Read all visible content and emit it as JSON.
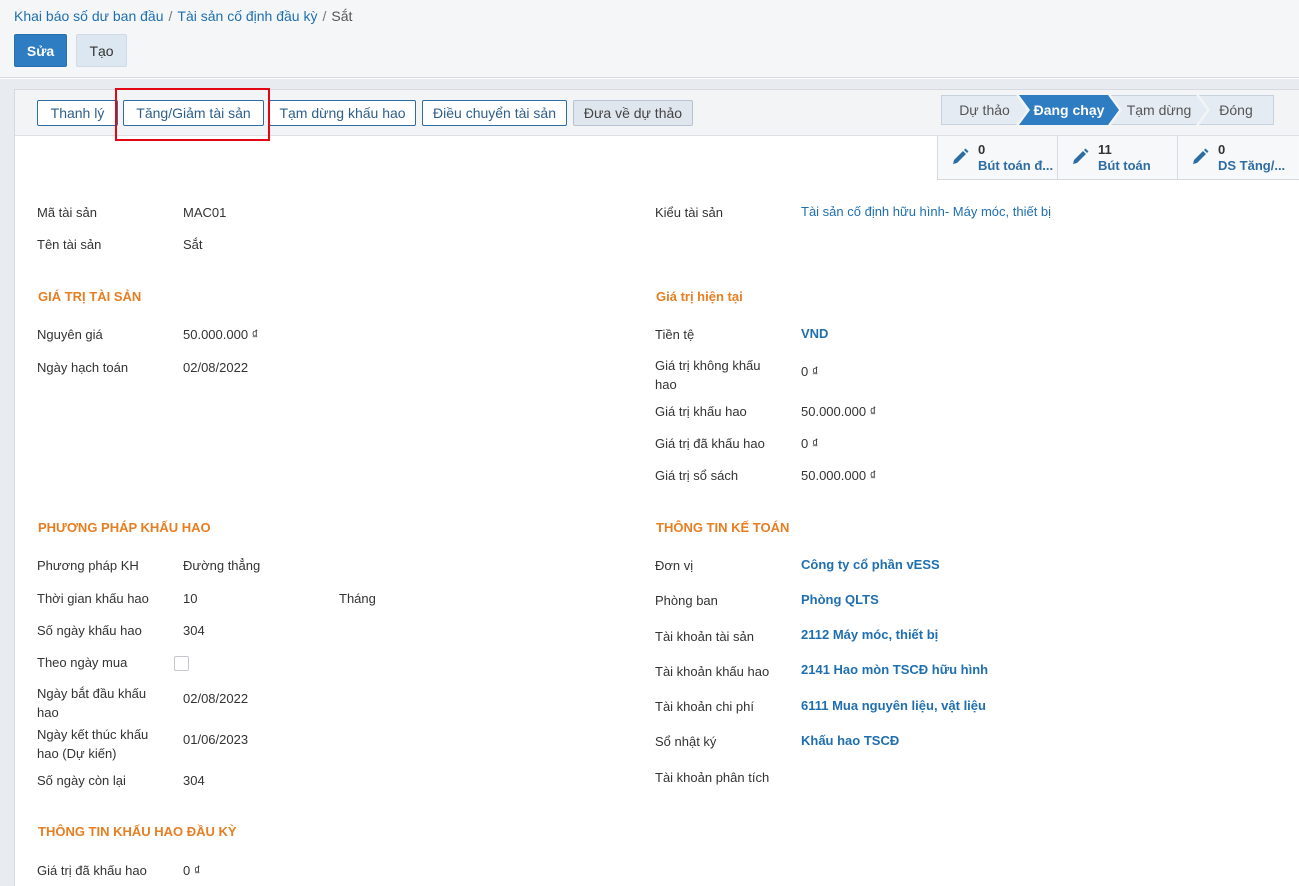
{
  "breadcrumb": {
    "item1": "Khai báo số dư ban đầu",
    "item2": "Tài sản cố định đầu kỳ",
    "current": "Sắt",
    "separator": "/"
  },
  "control": {
    "edit_label": "Sửa",
    "create_label": "Tạo"
  },
  "header_buttons": {
    "liquidate": "Thanh lý",
    "increase_decrease": "Tăng/Giảm tài sản",
    "pause_depreciation": "Tạm dừng khấu hao",
    "transfer": "Điều chuyển tài sản",
    "reset_draft": "Đưa về dự thảo"
  },
  "status": {
    "steps": [
      "Dự thảo",
      "Đang chạy",
      "Tạm dừng",
      "Đóng"
    ],
    "active": "Đang chạy"
  },
  "smart_buttons": [
    {
      "count": "0",
      "label": "Bút toán đ...",
      "icon": "pencil-icon"
    },
    {
      "count": "11",
      "label": "Bút toán",
      "icon": "pencil-icon"
    },
    {
      "count": "0",
      "label": "DS Tăng/...",
      "icon": "pencil-icon"
    }
  ],
  "general": {
    "asset_code_label": "Mã tài sản",
    "asset_code": "MAC01",
    "asset_name_label": "Tên tài sản",
    "asset_name": "Sắt",
    "asset_type_label": "Kiểu tài sản",
    "asset_type": "Tài sản cố định hữu hình- Máy móc, thiết bị"
  },
  "asset_value": {
    "title": "GIÁ TRỊ TÀI SẢN",
    "original_price_label": "Nguyên giá",
    "original_price": "50.000.000 ₫",
    "accounting_date_label": "Ngày hạch toán",
    "accounting_date": "02/08/2022"
  },
  "current_value": {
    "title": "Giá trị hiện tại",
    "currency_label": "Tiền tệ",
    "currency": "VND",
    "non_depreciable_label": "Giá trị không khấu hao",
    "non_depreciable": "0 ₫",
    "depreciable_label": "Giá trị khấu hao",
    "depreciable": "50.000.000 ₫",
    "depreciated_label": "Giá trị đã khấu hao",
    "depreciated": "0 ₫",
    "book_value_label": "Giá trị sổ sách",
    "book_value": "50.000.000 ₫"
  },
  "depreciation_method": {
    "title": "PHƯƠNG PHÁP KHẤU HAO",
    "method_label": "Phương pháp KH",
    "method": "Đường thẳng",
    "duration_label": "Thời gian khấu hao",
    "duration": "10",
    "duration_unit": "Tháng",
    "days_label": "Số ngày khấu hao",
    "days": "304",
    "by_purchase_date_label": "Theo ngày mua",
    "by_purchase_date": false,
    "start_date_label": "Ngày bắt đầu khấu hao",
    "start_date": "02/08/2022",
    "end_date_label": "Ngày kết thúc khấu hao (Dự kiến)",
    "end_date": "01/06/2023",
    "remaining_days_label": "Số ngày còn lại",
    "remaining_days": "304"
  },
  "accounting_info": {
    "title": "THÔNG TIN KẾ TOÁN",
    "company_label": "Đơn vị",
    "company": "Công ty cổ phần vESS",
    "department_label": "Phòng ban",
    "department": "Phòng QLTS",
    "asset_account_label": "Tài khoản tài sản",
    "asset_account": "2112 Máy móc, thiết bị",
    "depreciation_account_label": "Tài khoản khấu hao",
    "depreciation_account": "2141 Hao mòn TSCĐ hữu hình",
    "expense_account_label": "Tài khoản chi phí",
    "expense_account": "6111 Mua nguyên liệu, vật liệu",
    "journal_label": "Sổ nhật ký",
    "journal": "Khấu hao TSCĐ",
    "analytic_account_label": "Tài khoản phân tích",
    "analytic_account": ""
  },
  "opening_depreciation": {
    "title": "THÔNG TIN KHẤU HAO ĐẦU KỲ",
    "depreciated_label": "Giá trị đã khấu hao",
    "depreciated": "0 ₫"
  },
  "colors": {
    "primary": "#2e7cc2",
    "link": "#1f6fb0",
    "section_title": "#e67e22",
    "highlight": "#e30613"
  }
}
